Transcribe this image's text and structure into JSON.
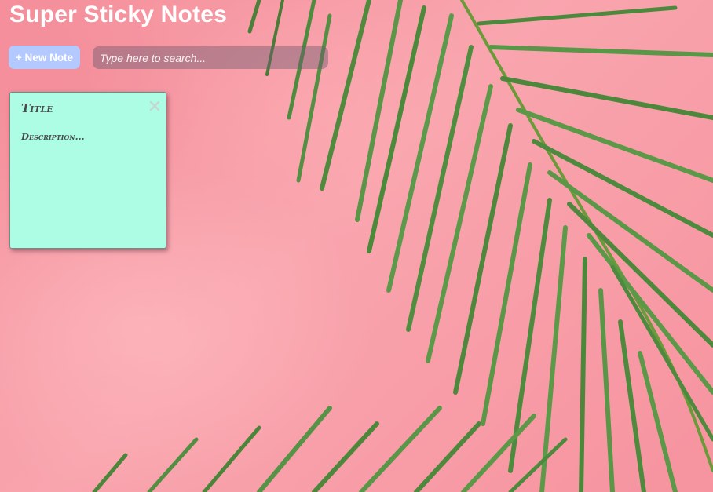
{
  "app": {
    "title": "Super Sticky Notes"
  },
  "toolbar": {
    "new_note_label": "+ New Note",
    "search_placeholder": "Type here to search...",
    "search_value": ""
  },
  "notes": [
    {
      "title_placeholder": "Title",
      "title_value": "",
      "description_placeholder": "Description...",
      "description_value": ""
    }
  ],
  "colors": {
    "background": "#f79aa4",
    "accent_button": "#b3c9ff",
    "note_background": "#adfce4",
    "title_text": "#ffffff",
    "palm_leaf": "#4d8a3c"
  },
  "icons": {
    "close": "close-icon",
    "background_decoration": "palm-leaf-decoration"
  }
}
